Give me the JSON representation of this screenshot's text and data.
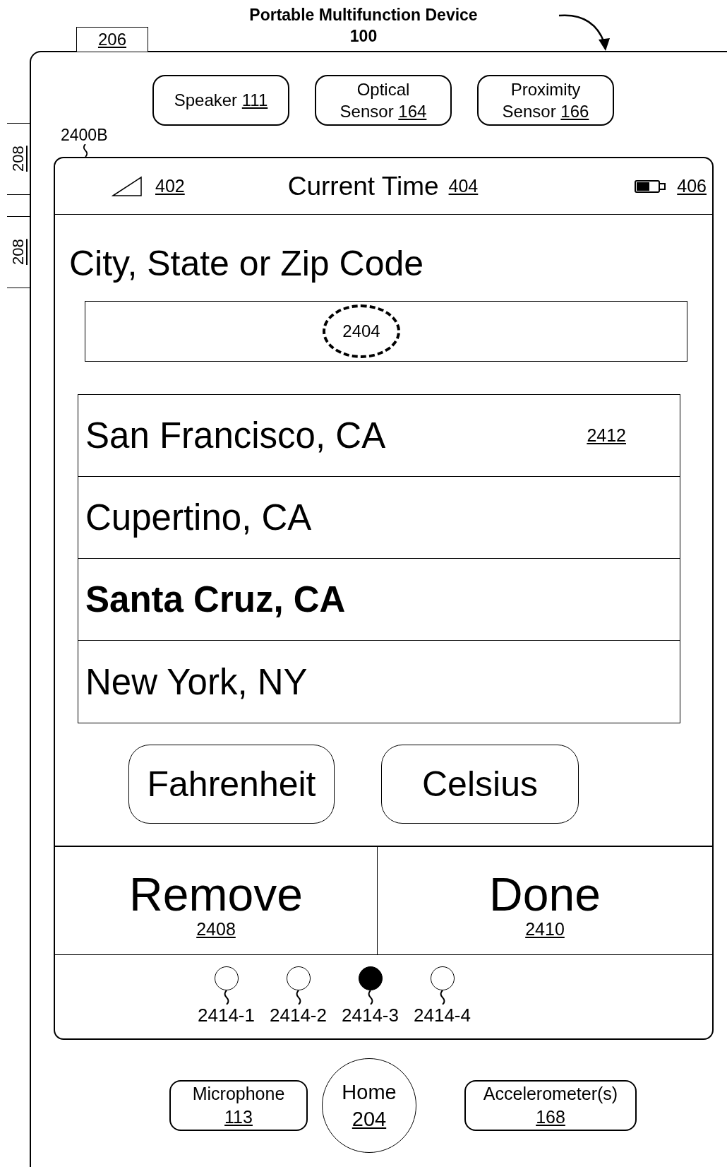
{
  "figure": {
    "title": "Portable Multifunction Device",
    "number": "100"
  },
  "side_buttons": [
    {
      "ref": "206",
      "kind": "top"
    },
    {
      "ref": "208",
      "kind": "left"
    },
    {
      "ref": "208",
      "kind": "left"
    }
  ],
  "sensors": [
    {
      "label": "Speaker",
      "ref": "111"
    },
    {
      "label": "Optical Sensor",
      "ref": "164"
    },
    {
      "label": "Proximity Sensor",
      "ref": "166"
    }
  ],
  "screen_ref": "2400B",
  "status_bar": {
    "signal_ref": "402",
    "title": "Current Time",
    "title_ref": "404",
    "battery_ref": "406"
  },
  "location": {
    "label": "City, State or Zip Code",
    "field_ref": "2404"
  },
  "cities": [
    {
      "name": "San Francisco, CA",
      "ref": "2412",
      "selected": false
    },
    {
      "name": "Cupertino, CA",
      "selected": false
    },
    {
      "name": "Santa Cruz, CA",
      "selected": true
    },
    {
      "name": "New York, NY",
      "selected": false
    }
  ],
  "unit_buttons": [
    "Fahrenheit",
    "Celsius"
  ],
  "actions": [
    {
      "label": "Remove",
      "ref": "2408"
    },
    {
      "label": "Done",
      "ref": "2410"
    }
  ],
  "page_dots": [
    {
      "label": "2414-1",
      "selected": false
    },
    {
      "label": "2414-2",
      "selected": false
    },
    {
      "label": "2414-3",
      "selected": true
    },
    {
      "label": "2414-4",
      "selected": false
    }
  ],
  "hardware": [
    {
      "label": "Microphone",
      "ref": "113",
      "kind": "pill"
    },
    {
      "label": "Home",
      "ref": "204",
      "kind": "circle"
    },
    {
      "label": "Accelerometer(s)",
      "ref": "168",
      "kind": "pill"
    }
  ]
}
